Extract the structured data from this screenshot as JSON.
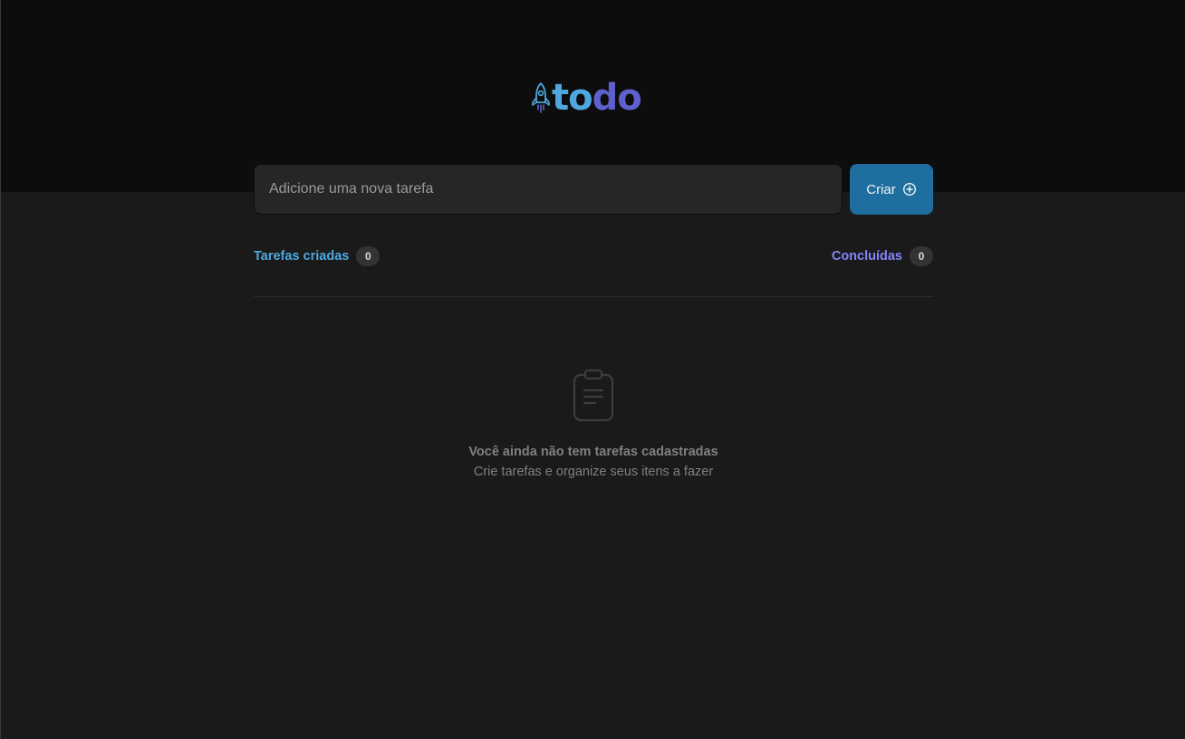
{
  "app": {
    "logo_text_start": "to",
    "logo_text_end": "do",
    "logo_icon": "rocket-icon"
  },
  "new_task": {
    "placeholder": "Adicione uma nova tarefa",
    "value": ""
  },
  "create_button": {
    "label": "Criar",
    "icon": "plus-circle-icon"
  },
  "counters": {
    "created_label": "Tarefas criadas",
    "created_count": "0",
    "done_label": "Concluídas",
    "done_count": "0"
  },
  "empty_state": {
    "icon": "clipboard-icon",
    "title": "Você ainda não tem tarefas cadastradas",
    "subtitle": "Crie tarefas e organize seus itens a fazer"
  },
  "colors": {
    "header_bg": "#0d0d0d",
    "body_bg": "#1a1a1a",
    "input_bg": "#262626",
    "button_bg": "#1e6f9f",
    "blue": "#4ea8de",
    "purple": "#8284fa",
    "badge_bg": "#333333",
    "muted_text": "#808080"
  }
}
